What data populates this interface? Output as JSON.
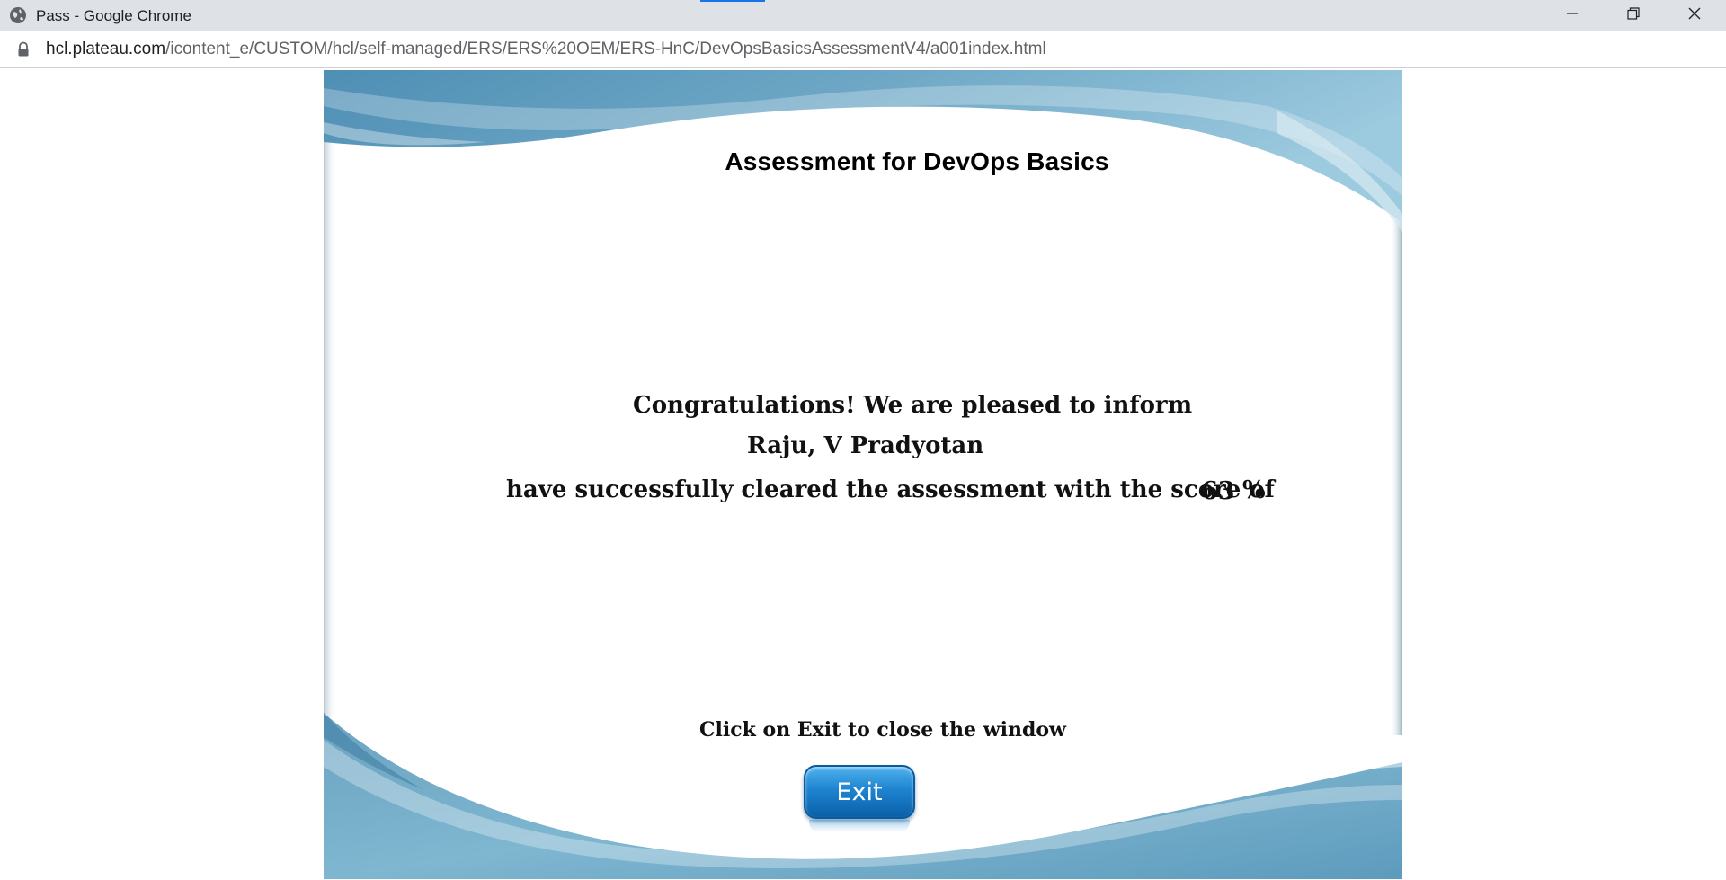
{
  "window": {
    "title": "Pass - Google Chrome"
  },
  "address_bar": {
    "host": "hcl.plateau.com",
    "path": "/icontent_e/CUSTOM/hcl/self-managed/ERS/ERS%20OEM/ERS-HnC/DevOpsBasicsAssessmentV4/a001index.html"
  },
  "page": {
    "heading": "Assessment for DevOps Basics",
    "congrats_line": "Congratulations! We are pleased to inform",
    "name": "Raju, V Pradyotan",
    "cleared_line": "have successfully cleared the assessment with the score of",
    "score": "63",
    "percent_sign": "%",
    "exit_hint": "Click on Exit to close the window",
    "exit_button_label": "Exit"
  },
  "icons": {
    "window": "globe-icon",
    "lock": "lock-icon",
    "minimize": "minimize-icon",
    "maximize": "restore-icon",
    "close": "close-icon"
  },
  "colors": {
    "chrome_bar": "#dee1e6",
    "wave_blue": "#5f9fbf",
    "button_blue": "#1f84d0"
  }
}
